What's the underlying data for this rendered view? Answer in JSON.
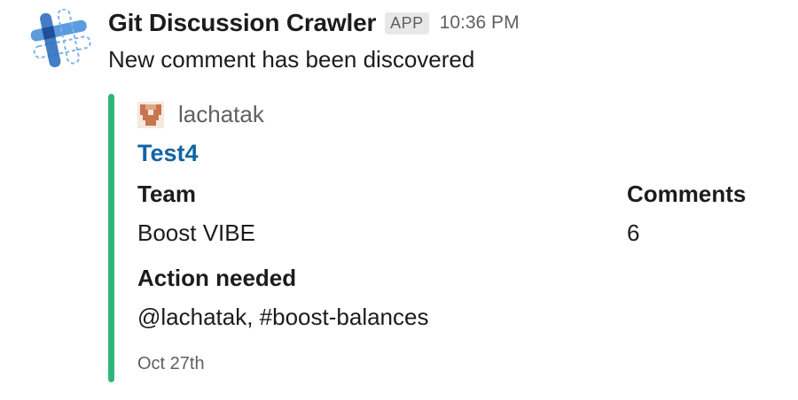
{
  "bot": {
    "name": "Git Discussion Crawler",
    "badge": "APP",
    "time": "10:36 PM",
    "avatar_icon": "hashtag-logo-icon"
  },
  "message": {
    "text": "New comment has been discovered"
  },
  "attachment": {
    "color": "#2eb67d",
    "author": {
      "name": "lachatak",
      "avatar_icon": "pixel-identicon-icon"
    },
    "title": "Test4",
    "fields": {
      "team": {
        "label": "Team",
        "value": "Boost VIBE"
      },
      "comments": {
        "label": "Comments",
        "value": "6"
      },
      "action": {
        "label": "Action needed",
        "value": "@lachatak, #boost-balances"
      }
    },
    "footer": "Oct 27th"
  }
}
